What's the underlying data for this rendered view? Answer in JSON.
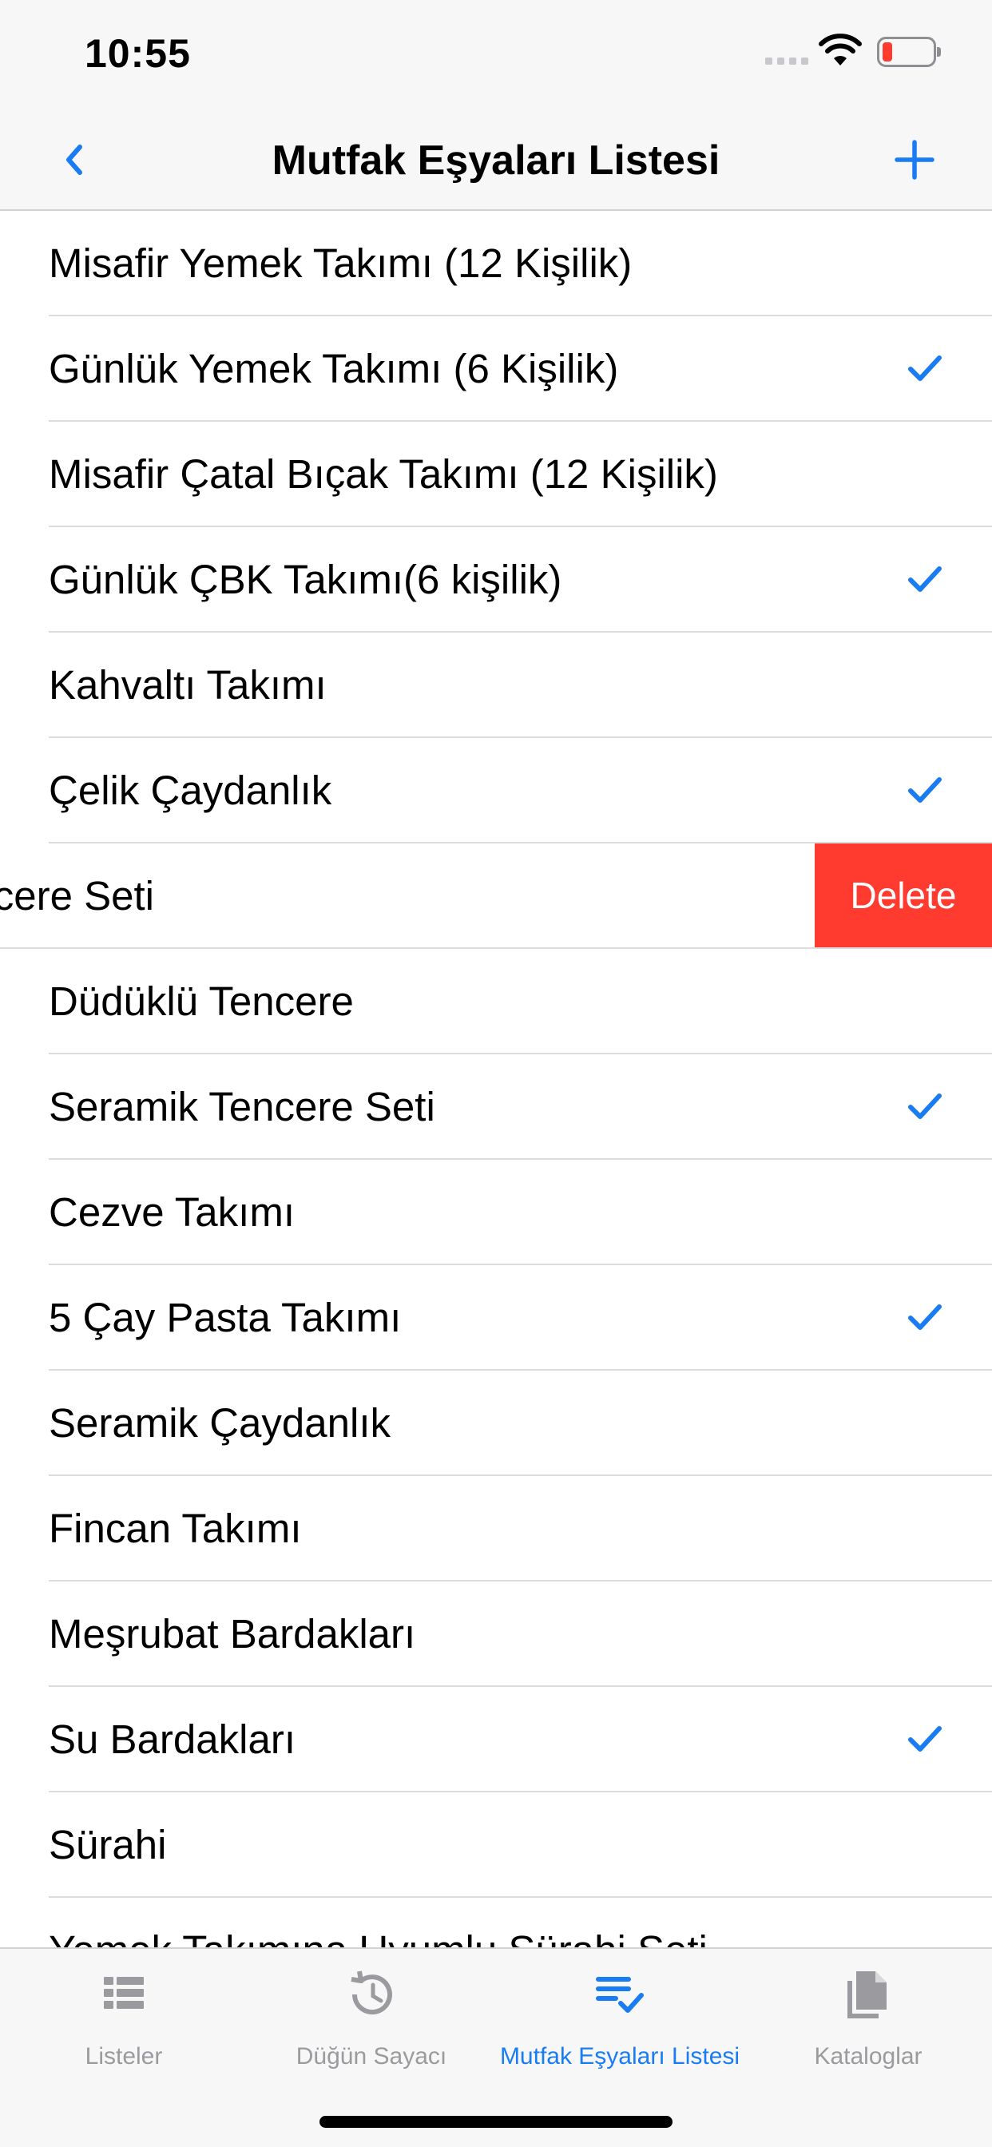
{
  "status_bar": {
    "time": "10:55"
  },
  "nav": {
    "title": "Mutfak Eşyaları Listesi",
    "back_icon": "chevron-left-icon",
    "add_icon": "plus-icon"
  },
  "colors": {
    "accent": "#1a7cf2",
    "delete": "#ff3b30",
    "bar_bg": "#f7f7f7",
    "tab_inactive": "#9b9b9f"
  },
  "list": {
    "items": [
      {
        "label": "Misafir Yemek Takımı (12 Kişilik)",
        "checked": false
      },
      {
        "label": "Günlük Yemek Takımı (6 Kişilik)",
        "checked": true
      },
      {
        "label": "Misafir Çatal Bıçak Takımı (12 Kişilik)",
        "checked": false
      },
      {
        "label": "Günlük ÇBK Takımı(6 kişilik)",
        "checked": true
      },
      {
        "label": "Kahvaltı Takımı",
        "checked": false
      },
      {
        "label": "Çelik Çaydanlık",
        "checked": true
      },
      {
        "label": "encere Seti",
        "checked": false,
        "swiped": true
      },
      {
        "label": "Düdüklü Tencere",
        "checked": false
      },
      {
        "label": "Seramik Tencere Seti",
        "checked": true
      },
      {
        "label": "Cezve Takımı",
        "checked": false
      },
      {
        "label": "5 Çay Pasta Takımı",
        "checked": true
      },
      {
        "label": "Seramik Çaydanlık",
        "checked": false
      },
      {
        "label": "Fincan Takımı",
        "checked": false
      },
      {
        "label": "Meşrubat Bardakları",
        "checked": false
      },
      {
        "label": "Su Bardakları",
        "checked": true
      },
      {
        "label": "Sürahi",
        "checked": false
      },
      {
        "label": "Yemek Takımına Uyumlu Sürahi Seti",
        "checked": false
      }
    ],
    "delete_label": "Delete"
  },
  "tabbar": {
    "tabs": [
      {
        "label": "Listeler",
        "icon": "list-icon",
        "active": false
      },
      {
        "label": "Düğün Sayacı",
        "icon": "history-icon",
        "active": false
      },
      {
        "label": "Mutfak Eşyaları Listesi",
        "icon": "playlist-check-icon",
        "active": true
      },
      {
        "label": "Kataloglar",
        "icon": "documents-icon",
        "active": false
      }
    ]
  }
}
